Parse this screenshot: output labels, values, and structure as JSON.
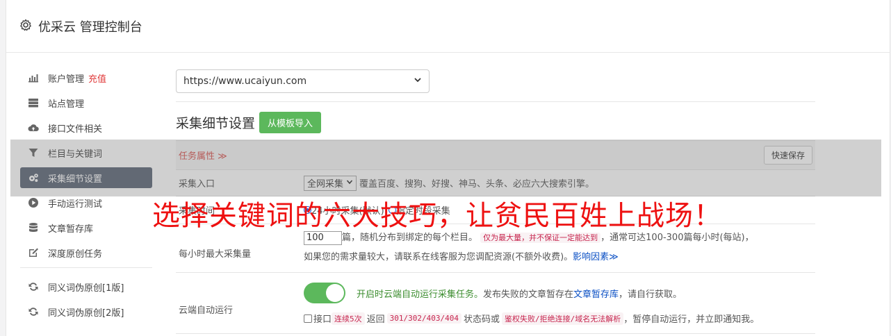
{
  "header": {
    "title": "优采云 管理控制台"
  },
  "sidebar": {
    "items": [
      {
        "label": "账户管理",
        "badge": "充值"
      },
      {
        "label": "站点管理"
      },
      {
        "label": "接口文件相关"
      },
      {
        "label": "栏目与关键词"
      },
      {
        "label": "采集细节设置"
      },
      {
        "label": "手动运行测试"
      },
      {
        "label": "文章暂存库"
      },
      {
        "label": "深度原创任务"
      },
      {
        "label": "同义词伪原创[1版]"
      },
      {
        "label": "同义词伪原创[2版]"
      }
    ]
  },
  "main": {
    "site_select": "https://www.ucaiyun.com",
    "section_title": "采集细节设置",
    "import_button": "从模板导入",
    "tab_label": "任务属性 ≫",
    "quick_save": "快速保存",
    "rows": {
      "entry_label": "采集入口",
      "entry_select": "全网采集",
      "entry_desc": "覆盖百度、搜狗、好搜、神马、头条、必应六大搜索引擎。",
      "mode_label": "采集时间",
      "mode_opt1": "24小时采集(默认)",
      "mode_opt2": "指定时段采集",
      "max_label": "每小时最大采集量",
      "max_value": "100",
      "max_text1": "篇，随机分布到绑定的每个栏目。",
      "max_code": "仅为最大量，并不保证一定能达到",
      "max_text2": "，通常可达100-300篇每小时(每站)，",
      "max_text3": "如果您的需求量较大，请联系在线客服为您调配资源(不额外收费)。",
      "max_link": "影响因素≫",
      "cloud_label": "云端自动运行",
      "cloud_text1": "开启时云端自动运行采集任务。",
      "cloud_text2": "发布失败的文章暂存在",
      "cloud_link": "文章暂存库",
      "cloud_text3": "，请自行获取。",
      "cb_text1": "接口",
      "cb_code1": "连续5次",
      "cb_text2": "返回",
      "cb_code2": "301/302/403/404",
      "cb_text3": "状态码或",
      "cb_code3": "鉴权失败/拒绝连接/域名无法解析",
      "cb_text4": "，暂停自动运行，并立即通知我。"
    }
  },
  "overlay": {
    "caption": "选择关键词的六大技巧，让贫民百姓上战场！"
  }
}
